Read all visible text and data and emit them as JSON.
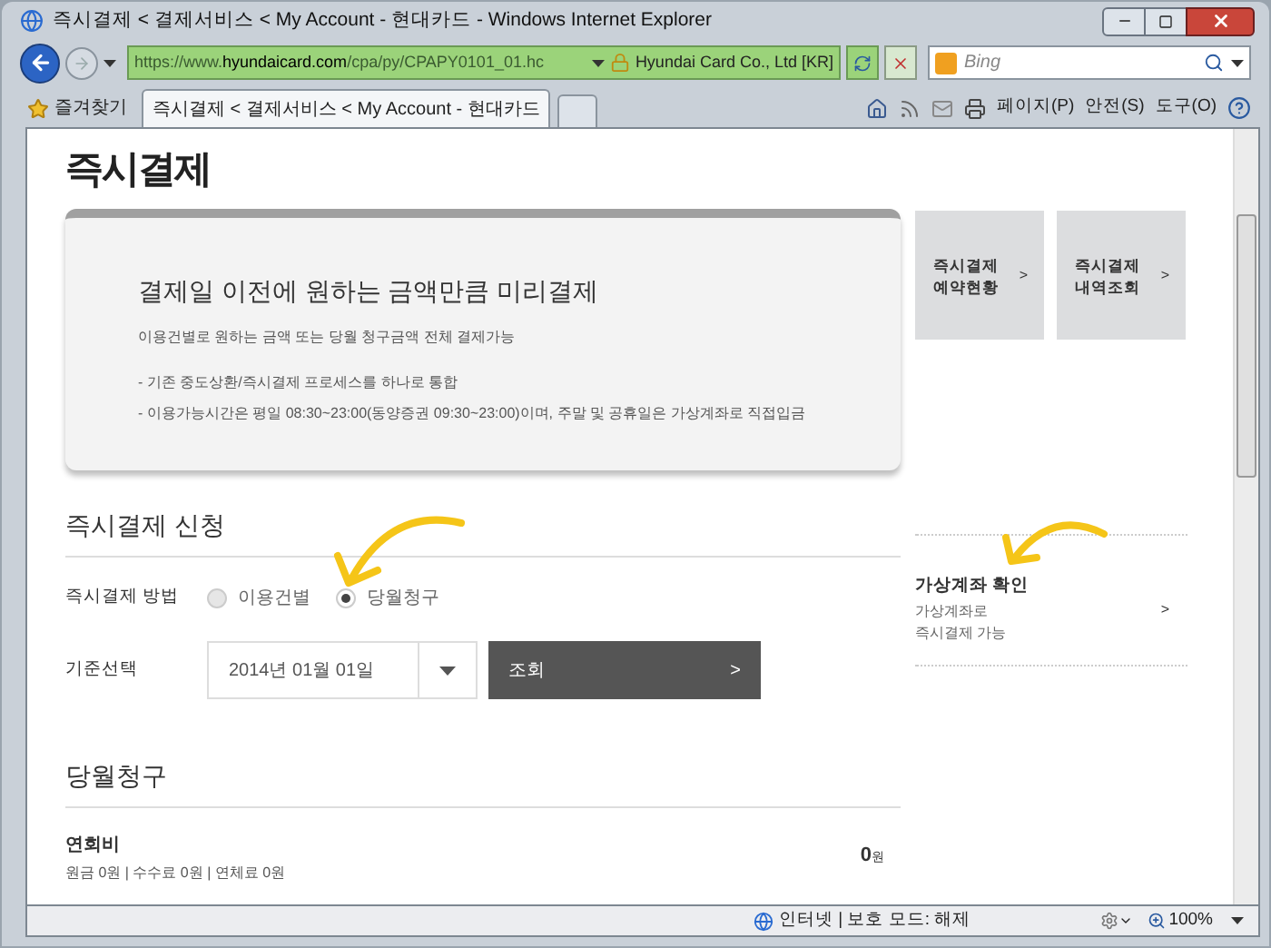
{
  "window": {
    "title": "즉시결제 < 결제서비스 < My Account - 현대카드 - Windows Internet Explorer"
  },
  "address_bar": {
    "url_prefix": "https://www.",
    "url_domain": "hyundaicard.com",
    "url_path": "/cpa/py/CPAPY0101_01.hc",
    "certificate": "Hyundai Card Co., Ltd [KR]"
  },
  "search": {
    "placeholder": "Bing"
  },
  "favorites": {
    "label": "즐겨찾기"
  },
  "tabs": [
    {
      "label": "즉시결제 < 결제서비스 < My Account - 현대카드",
      "selected": true
    }
  ],
  "command_bar": [
    "페이지(P)",
    "안전(S)",
    "도구(O)"
  ],
  "page": {
    "title": "즉시결제",
    "hero": {
      "heading": "결제일 이전에 원하는 금액만큼 미리결제",
      "subtitle": "이용건별로 원하는 금액 또는 당월 청구금액 전체 결제가능",
      "bullets": [
        "- 기존 중도상환/즉시결제 프로세스를 하나로 통합",
        "- 이용가능시간은 평일 08:30~23:00(동양증권 09:30~23:00)이며, 주말 및 공휴일은 가상계좌로 직접입금"
      ]
    },
    "side_links": [
      {
        "label_lines": [
          "즉시결제",
          "예약현황"
        ],
        "chevron": ">"
      },
      {
        "label_lines": [
          "즉시결제",
          "내역조회"
        ],
        "chevron": ">"
      }
    ],
    "apply": {
      "title": "즉시결제 신청",
      "method_label": "즉시결제 방법",
      "methods": [
        {
          "label": "이용건별",
          "selected": false
        },
        {
          "label": "당월청구",
          "selected": true
        }
      ],
      "date_label": "기준선택",
      "date_value": "2014년 01월 01일",
      "submit": "조회",
      "submit_chevron": ">"
    },
    "virtual_account": {
      "title": "가상계좌 확인",
      "lines": [
        "가상계좌로",
        "즉시결제 가능"
      ],
      "chevron": ">"
    },
    "billing": {
      "title": "당월청구",
      "items": [
        {
          "name": "연회비",
          "amount": "0",
          "unit": "원",
          "detail": "원금 0원 | 수수료 0원 | 연체료 0원"
        }
      ]
    }
  },
  "status_bar": {
    "zone": "인터넷 | 보호 모드: 해제",
    "zoom": "100%"
  }
}
